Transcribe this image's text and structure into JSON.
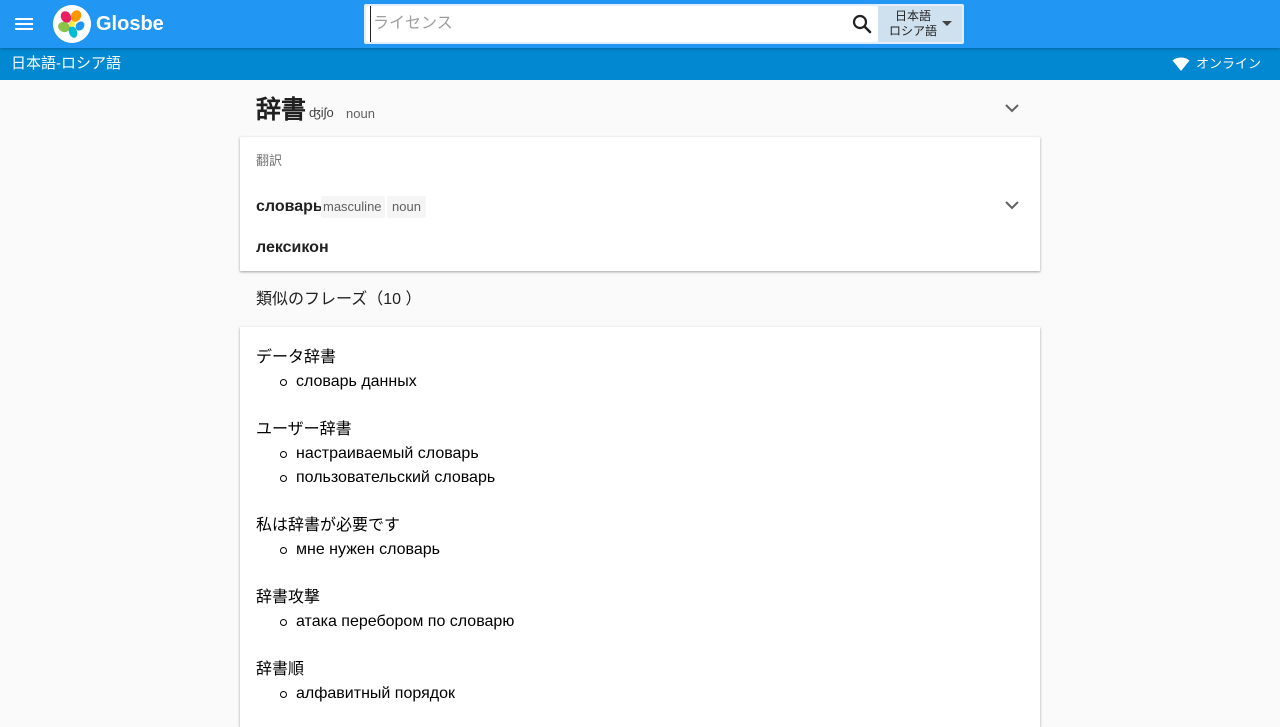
{
  "header": {
    "menu_icon": "menu-icon",
    "logo_icon": "glosbe-logo-icon",
    "brand": "Glosbe",
    "search": {
      "value": "",
      "placeholder": "ライセンス",
      "icon": "search-icon"
    },
    "language_selector": {
      "from": "日本語",
      "to": "ロシア語",
      "icon": "caret-down-icon"
    }
  },
  "subbar": {
    "title": "日本語-ロシア語",
    "status_icon": "wifi-icon",
    "status": "オンライン"
  },
  "entry": {
    "headword": "辞書",
    "ipa": "ʤiʃo",
    "pos": "noun",
    "expand_icon": "chevron-down-icon"
  },
  "translations": {
    "label": "翻訳",
    "items": [
      {
        "word": "словарь",
        "gender": "masculine",
        "pos": "noun",
        "expand_icon": "chevron-down-icon"
      },
      {
        "word": "лексикон"
      }
    ]
  },
  "similar_phrases": {
    "heading": "類似のフレーズ（10 ）",
    "items": [
      {
        "phrase": "データ辞書",
        "translations": [
          "словарь данных"
        ]
      },
      {
        "phrase": "ユーザー辞書",
        "translations": [
          "настраиваемый словарь",
          "пользовательский словарь"
        ]
      },
      {
        "phrase": "私は辞書が必要です",
        "translations": [
          "мне нужен словарь"
        ]
      },
      {
        "phrase": "辞書攻撃",
        "translations": [
          "атака перебором по словарю"
        ]
      },
      {
        "phrase": "辞書順",
        "translations": [
          "алфавитный порядок"
        ]
      }
    ]
  },
  "colors": {
    "app_bar": "#2196f3",
    "sub_bar": "#0288d1",
    "background": "#fafafa"
  }
}
